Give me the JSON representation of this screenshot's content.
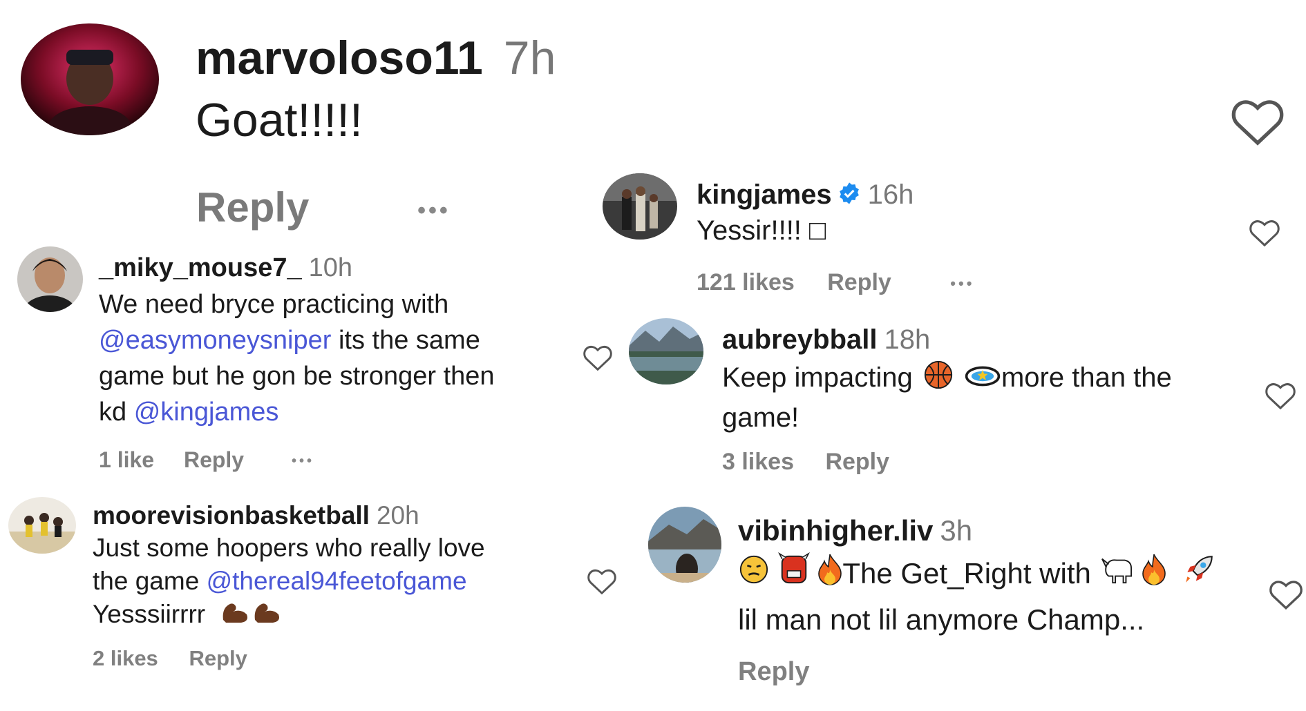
{
  "colors": {
    "mention": "#4a57d6",
    "meta": "#808080",
    "verified": "#1d8cf0",
    "heart_outline": "#555555"
  },
  "comments": {
    "marvoloso": {
      "username": "marvoloso11",
      "time": "7h",
      "text": "Goat!!!!!",
      "reply": "Reply",
      "more": "•••"
    },
    "miky": {
      "username": "_miky_mouse7_",
      "time": "10h",
      "line1": "We need bryce practicing with",
      "mention1": "@easymoneysniper",
      "line2_rest": " its the same",
      "line3": "game but he gon be stronger then",
      "line4_start": "kd ",
      "mention2": "@kingjames",
      "likes": "1 like",
      "reply": "Reply",
      "more": "•••"
    },
    "moore": {
      "username": "moorevisionbasketball",
      "time": "20h",
      "line1": "Just some hoopers who really love",
      "line2_start": "the game ",
      "mention1": "@thereal94feetofgame",
      "line3": "Yesssiirrrr",
      "likes": "2 likes",
      "reply": "Reply"
    },
    "king": {
      "username": "kingjames",
      "time": "16h",
      "text": "Yessir!!!! □",
      "likes": "121 likes",
      "reply": "Reply",
      "more": "•••"
    },
    "aubrey": {
      "username": "aubreybball",
      "time": "18h",
      "line1_start": "Keep impacting ",
      "line1_end": "more than the",
      "line2": "game!",
      "likes": "3 likes",
      "reply": "Reply"
    },
    "vibin": {
      "username": "vibinhigher.liv",
      "time": "3h",
      "line1_text": "The Get_Right with",
      "line2": "lil man not lil anymore Champ...",
      "reply": "Reply"
    }
  },
  "icons": [
    "heart-outline-icon",
    "verified-badge-icon",
    "flexed-biceps-emoji",
    "basketball-emoji",
    "fire-emoji",
    "goat-emoji",
    "rocket-emoji"
  ]
}
